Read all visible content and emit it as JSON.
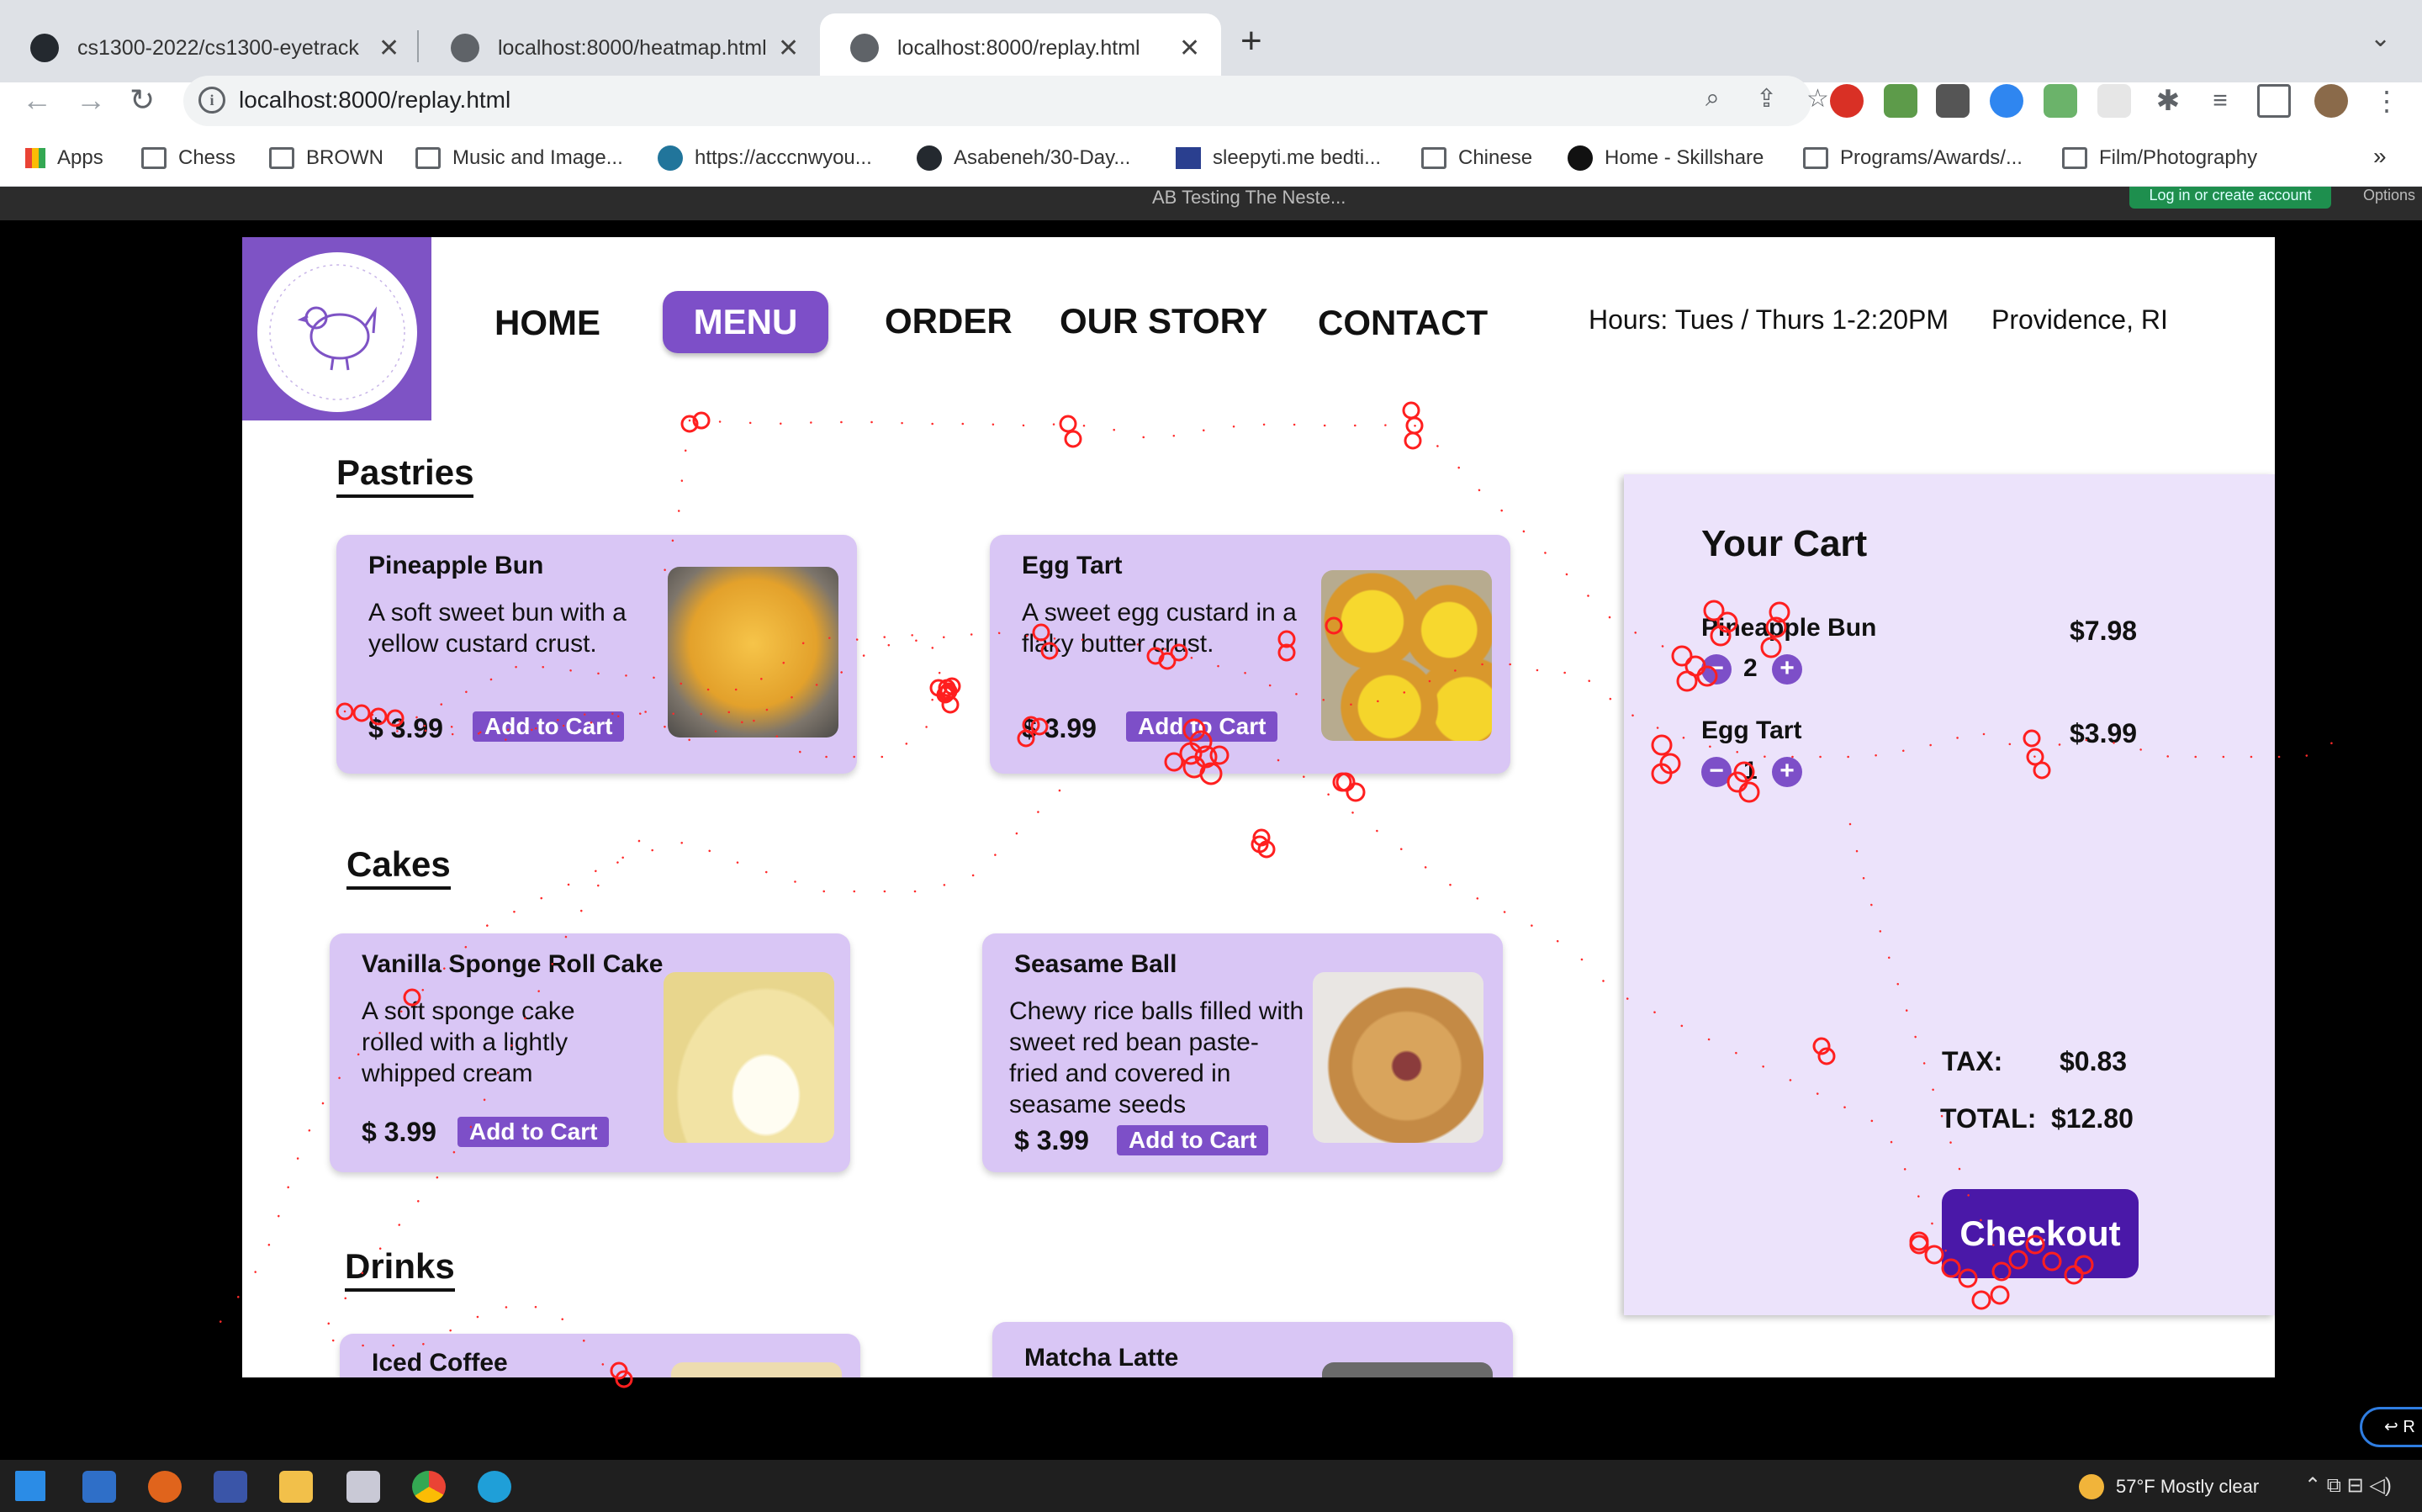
{
  "browser": {
    "tabs": [
      {
        "title": "cs1300-2022/cs1300-eyetrack",
        "active": false,
        "icon": "github-icon"
      },
      {
        "title": "localhost:8000/heatmap.html",
        "active": false,
        "icon": "globe-icon"
      },
      {
        "title": "localhost:8000/replay.html",
        "active": true,
        "icon": "globe-icon"
      }
    ],
    "new_tab": "+",
    "url": "localhost:8000/replay.html",
    "bookmarks": [
      {
        "label": "Apps",
        "icon": "apps-grid-icon"
      },
      {
        "label": "Chess",
        "icon": "folder-icon"
      },
      {
        "label": "BROWN",
        "icon": "folder-icon"
      },
      {
        "label": "Music and Image...",
        "icon": "folder-icon"
      },
      {
        "label": "https://acccnwyou...",
        "icon": "wordpress-icon"
      },
      {
        "label": "Asabeneh/30-Day...",
        "icon": "github-icon"
      },
      {
        "label": "sleepyti.me bedti...",
        "icon": "sleepytime-icon"
      },
      {
        "label": "Chinese",
        "icon": "folder-icon"
      },
      {
        "label": "Home - Skillshare",
        "icon": "skillshare-icon"
      },
      {
        "label": "Programs/Awards/...",
        "icon": "folder-icon"
      },
      {
        "label": "Film/Photography",
        "icon": "folder-icon"
      }
    ],
    "more": "»"
  },
  "figma_bar": {
    "title": "AB Testing The Neste...",
    "login": "Log in or create account",
    "options": "Options"
  },
  "site": {
    "nav": [
      "HOME",
      "MENU",
      "ORDER",
      "OUR STORY",
      "CONTACT"
    ],
    "active_nav": "MENU",
    "hours": "Hours: Tues / Thurs 1-2:20PM",
    "location": "Providence, RI",
    "logo_text": "The Nest Bakery",
    "sections": {
      "pastries": "Pastries",
      "cakes": "Cakes",
      "drinks": "Drinks"
    },
    "products": [
      {
        "name": "Pineapple Bun",
        "desc": "A soft sweet bun with a yellow custard crust.",
        "price": "$ 3.99",
        "button": "Add to Cart"
      },
      {
        "name": "Egg Tart",
        "desc": "A sweet egg custard in a flaky butter crust.",
        "price": "$ 3.99",
        "button": "Add to Cart"
      },
      {
        "name": "Vanilla Sponge Roll Cake",
        "desc": "A soft sponge cake rolled with a lightly whipped cream",
        "price": "$ 3.99",
        "button": "Add to Cart"
      },
      {
        "name": "Seasame Ball",
        "desc": "Chewy rice balls filled with sweet red bean paste- fried and covered in seasame seeds",
        "price": "$ 3.99",
        "button": "Add to Cart"
      },
      {
        "name": "Iced Coffee"
      },
      {
        "name": "Matcha Latte"
      }
    ],
    "cart": {
      "title": "Your Cart",
      "items": [
        {
          "name": "Pineapple Bun",
          "qty": "2",
          "price": "$7.98"
        },
        {
          "name": "Egg Tart",
          "qty": "1",
          "price": "$3.99"
        }
      ],
      "minus": "−",
      "plus": "+",
      "tax_label": "TAX:",
      "tax": "$0.83",
      "total_label": "TOTAL:",
      "total": "$12.80",
      "checkout": "Checkout"
    }
  },
  "replay_button": "↩ R",
  "taskbar": {
    "weather": "57°F  Mostly clear"
  },
  "colors": {
    "accent_purple": "#7d4fc8",
    "card_bg": "#d9c6f5",
    "cart_bg": "#ece3fb",
    "checkout": "#4a18a8",
    "gaze_points": "#ff2a2a"
  }
}
